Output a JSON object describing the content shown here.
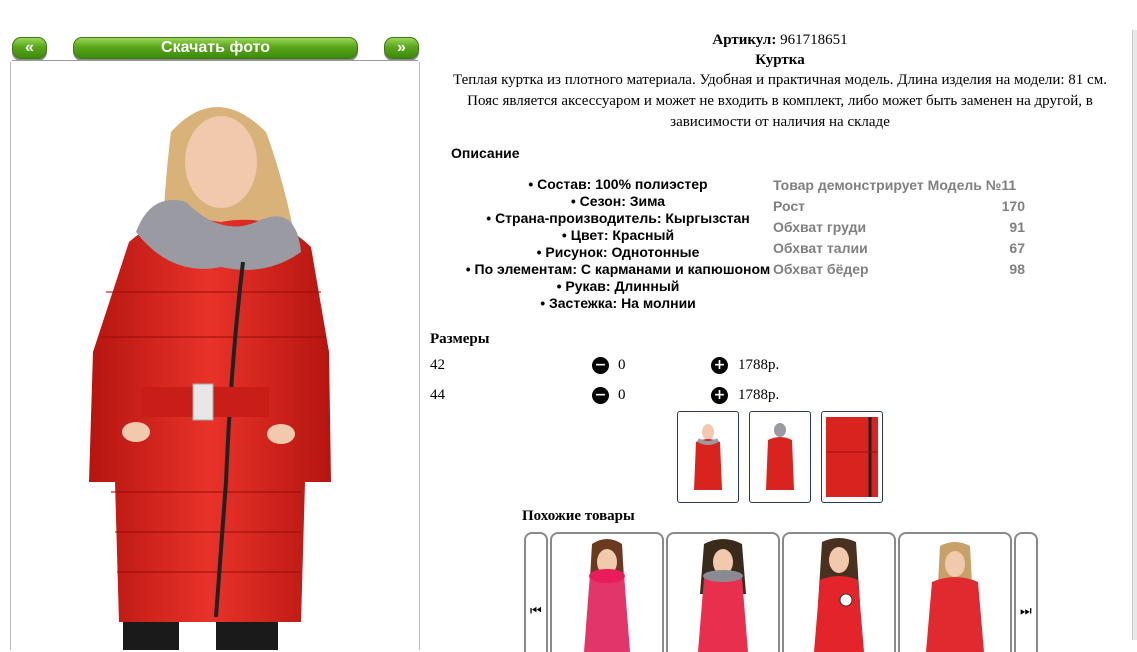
{
  "nav": {
    "prev_label": "«",
    "download_label": "Скачать фото",
    "next_label": "»"
  },
  "product": {
    "article_label": "Артикул:",
    "article_value": "961718651",
    "name": "Куртка",
    "description_line1": "Теплая куртка из плотного материала. Удобная и практичная модель. Длина изделия на модели: 81 см.",
    "description_line2": "Пояс является аксессуаром и может не входить в комплект, либо может быть заменен на другой, в",
    "description_line3": "зависимости от наличия на складе",
    "description_heading": "Описание",
    "attributes": [
      "• Состав: 100% полиэстер",
      "• Сезон: Зима",
      "• Страна-производитель: Кыргызстан",
      "• Цвет: Красный",
      "• Рисунок: Однотонные",
      "• По элементам: С карманами и капюшоном",
      "• Рукав: Длинный",
      "• Застежка: На молнии"
    ]
  },
  "model": {
    "title": "Товар демонстрирует Модель №11",
    "rows": [
      {
        "label": "Рост",
        "value": "170"
      },
      {
        "label": "Обхват груди",
        "value": "91"
      },
      {
        "label": "Обхват талии",
        "value": "67"
      },
      {
        "label": "Обхват бёдер",
        "value": "98"
      }
    ]
  },
  "sizes": {
    "heading": "Размеры",
    "rows": [
      {
        "size": "42",
        "qty": "0",
        "price": "1788р."
      },
      {
        "size": "44",
        "qty": "0",
        "price": "1788р."
      }
    ]
  },
  "similar": {
    "heading": "Похожие товары"
  },
  "colors": {
    "jacket_red": "#d8231f",
    "nav_green": "#5aa61a"
  },
  "icons": {
    "minus": "minus-circle-icon",
    "plus": "plus-circle-icon",
    "prev": "skip-prev-icon",
    "next": "skip-next-icon"
  }
}
